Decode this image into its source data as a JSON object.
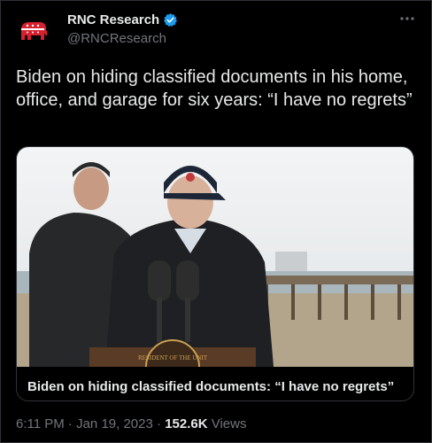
{
  "account": {
    "name": "RNC Research",
    "handle": "@RNCResearch",
    "avatar_icon": "republican-elephant-icon",
    "verified_color": "#1d9bf0"
  },
  "menu_icon": "more-dots-icon",
  "tweet": {
    "text": "Biden on hiding classified documents in his home, office, and garage for six years: “I have no regrets”"
  },
  "media": {
    "caption": "Biden on hiding classified documents: “I have no regrets”",
    "podium_seal_text": "RESIDENT OF THE UNIT"
  },
  "meta": {
    "time": "6:11 PM",
    "separator": "·",
    "date": "Jan 19, 2023",
    "views_count": "152.6K",
    "views_label": "Views"
  },
  "colors": {
    "background": "#000000",
    "text": "#e7e9ea",
    "muted": "#71767b",
    "border": "#2f3336",
    "brand_red": "#d5202f"
  }
}
